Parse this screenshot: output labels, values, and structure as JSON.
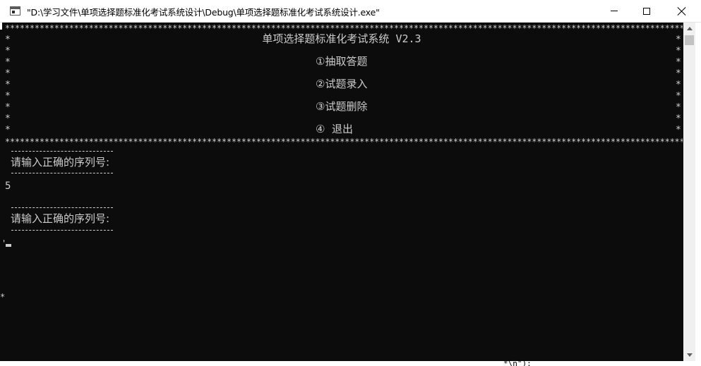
{
  "window": {
    "title": "\"D:\\学习文件\\单项选择题标准化考试系统设计\\Debug\\单项选择题标准化考试系统设计.exe\"",
    "controls": {
      "minimize": "minimize-icon",
      "maximize": "maximize-icon",
      "close": "close-icon"
    }
  },
  "console": {
    "star_border": "*******************************************************************************************************************************************",
    "edge_char": "*",
    "header_title": "单项选择题标准化考试系统 V2.3",
    "menu": [
      {
        "label": "①抽取答题"
      },
      {
        "label": "②试题录入"
      },
      {
        "label": "③试题删除"
      },
      {
        "label": "④  退出"
      }
    ],
    "prompts": [
      {
        "text": "请输入正确的序列号:"
      },
      {
        "text": "请输入正确的序列号:"
      }
    ],
    "user_input": "5",
    "stray_chars": {
      "tick": "'",
      "asterisk": "*"
    }
  },
  "background_text": "*\\n\");",
  "colors": {
    "console_bg": "#0c0c0c",
    "console_fg": "#cccccc",
    "titlebar_bg": "#ffffff"
  }
}
